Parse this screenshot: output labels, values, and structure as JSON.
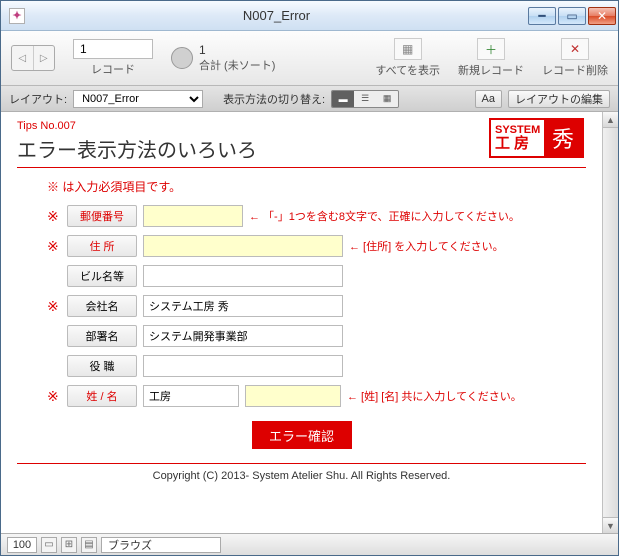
{
  "window": {
    "title": "N007_Error"
  },
  "toolbar": {
    "record_current": "1",
    "record_label": "レコード",
    "total_count": "1",
    "total_label": "合計 (未ソート)",
    "show_all": "すべてを表示",
    "new_record": "新規レコード",
    "delete_record": "レコード削除"
  },
  "layoutbar": {
    "layout_label": "レイアウト:",
    "layout_value": "N007_Error",
    "view_switch_label": "表示方法の切り替え:",
    "aa": "Aa",
    "edit_layout": "レイアウトの編集"
  },
  "page": {
    "tips_no": "Tips No.007",
    "title": "エラー表示方法のいろいろ",
    "logo_system": "SYSTEM",
    "logo_kobo": "工房",
    "logo_mark": "秀",
    "required_note": "※ は入力必須項目です。",
    "submit": "エラー確認",
    "copyright": "Copyright (C) 2013- System Atelier Shu. All Rights Reserved."
  },
  "fields": {
    "postal": {
      "label": "郵便番号",
      "value": "",
      "hint": "← 「-」1つを含む8文字で、正確に入力してください。"
    },
    "address": {
      "label": "住 所",
      "value": "",
      "hint": "← [住所] を入力してください。"
    },
    "building": {
      "label": "ビル名等",
      "value": ""
    },
    "company": {
      "label": "会社名",
      "value": "システム工房 秀"
    },
    "dept": {
      "label": "部署名",
      "value": "システム開発事業部"
    },
    "position": {
      "label": "役 職",
      "value": ""
    },
    "name_sei": {
      "value": "工房"
    },
    "name_mei": {
      "value": ""
    },
    "name": {
      "label": "姓 / 名",
      "hint": "← [姓] [名] 共に入力してください。"
    }
  },
  "status": {
    "zoom": "100",
    "mode": "ブラウズ"
  },
  "req_mark": "※"
}
